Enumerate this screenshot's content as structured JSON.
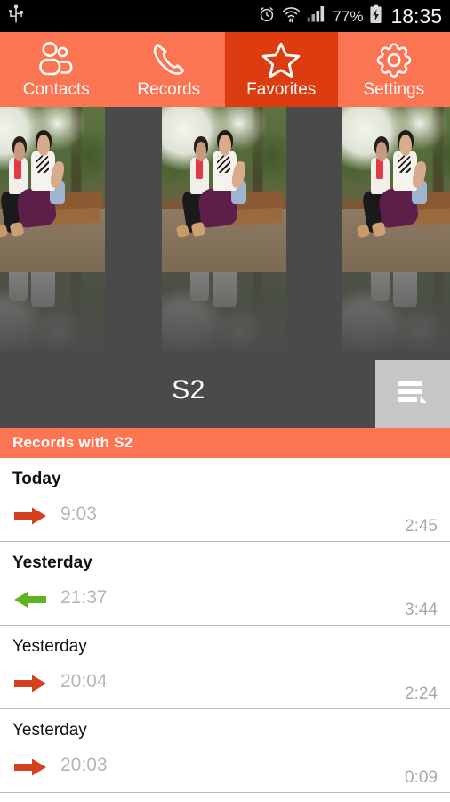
{
  "statusbar": {
    "usb_icon": "usb-icon",
    "alarm_icon": "alarm-clock-icon",
    "wifi_icon": "wifi-icon",
    "signal_icon": "cellular-signal-icon",
    "battery_percent": "77%",
    "battery_icon": "battery-charging-icon",
    "clock": "18:35"
  },
  "tabs": [
    {
      "label": "Contacts",
      "icon": "contacts-icon",
      "active": false
    },
    {
      "label": "Records",
      "icon": "phone-handset-icon",
      "active": false
    },
    {
      "label": "Favorites",
      "icon": "star-icon",
      "active": true
    },
    {
      "label": "Settings",
      "icon": "gear-icon",
      "active": false
    }
  ],
  "carousel": {
    "photo_alt": "two women seated on a park bench",
    "slides": 3
  },
  "contact": {
    "name": "S2",
    "menu_icon": "list-menu-icon"
  },
  "section": {
    "title": "Records with S2"
  },
  "records": [
    {
      "day": "Today",
      "day_bold": true,
      "direction": "outgoing",
      "direction_icon": "arrow-right-icon",
      "time": "9:03",
      "duration": "2:45"
    },
    {
      "day": "Yesterday",
      "day_bold": true,
      "direction": "incoming",
      "direction_icon": "arrow-left-icon",
      "time": "21:37",
      "duration": "3:44"
    },
    {
      "day": "Yesterday",
      "day_bold": false,
      "direction": "outgoing",
      "direction_icon": "arrow-right-icon",
      "time": "20:04",
      "duration": "2:24"
    },
    {
      "day": "Yesterday",
      "day_bold": false,
      "direction": "outgoing",
      "direction_icon": "arrow-right-icon",
      "time": "20:03",
      "duration": "0:09"
    }
  ],
  "colors": {
    "accent_orange": "#fb7553",
    "active_tab": "#dd3b10",
    "dark_gray": "#4a4a4a",
    "outgoing_arrow": "#d3411f",
    "incoming_arrow": "#5fb220",
    "menu_button": "#c6c6c6"
  }
}
